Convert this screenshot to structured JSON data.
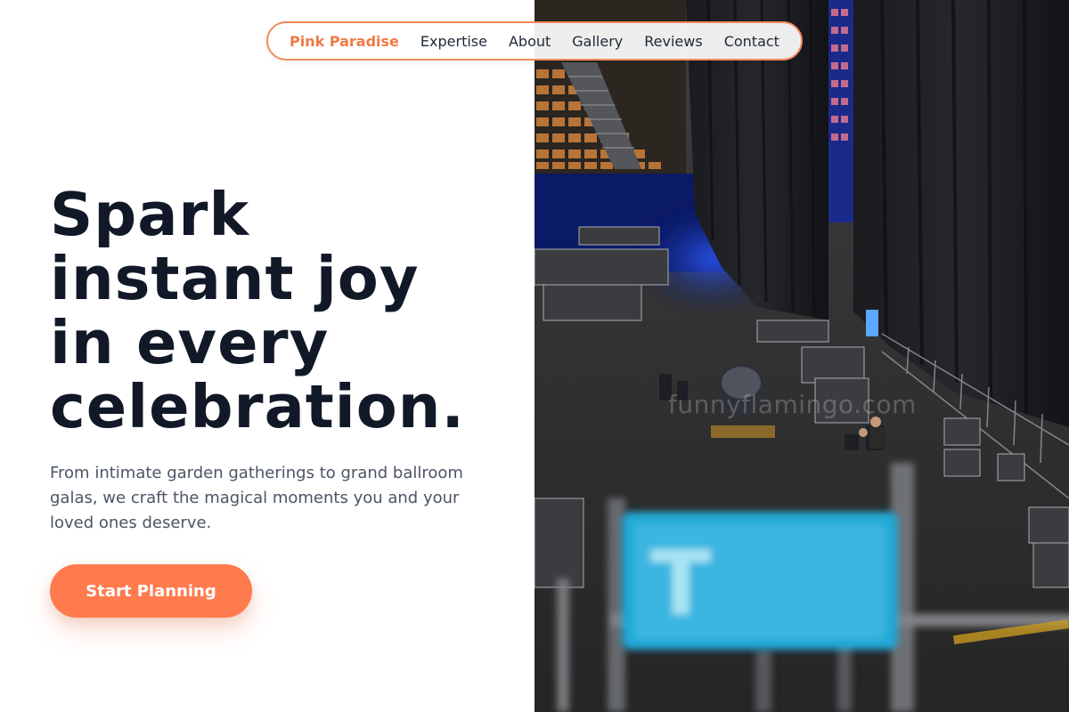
{
  "nav": {
    "brand": "Pink Paradise",
    "links": [
      "Expertise",
      "About",
      "Gallery",
      "Reviews",
      "Contact"
    ]
  },
  "hero": {
    "headline_lines": [
      "Spark",
      "instant joy",
      "in every",
      "celebration."
    ],
    "subtext": "From intimate garden gatherings to grand ballroom galas, we craft the magical moments you and your loved ones deserve.",
    "cta_label": "Start Planning"
  },
  "photo": {
    "watermark": "funnyflamingo.com",
    "sign_text": "T"
  },
  "colors": {
    "accent": "#ff7a4d",
    "brand_text": "#f07a45",
    "nav_border": "#f28a5e",
    "headline": "#111827",
    "body_text": "#4b5563"
  }
}
